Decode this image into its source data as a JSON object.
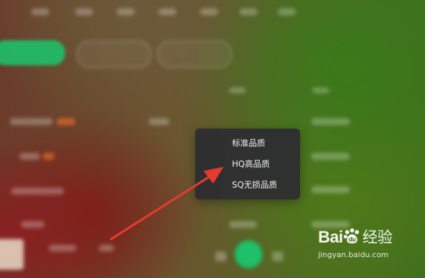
{
  "quality_menu": {
    "items": [
      {
        "label": "标准品质"
      },
      {
        "label": "HQ高品质"
      },
      {
        "label": "SQ无损品质"
      }
    ]
  },
  "annotation": {
    "arrow_color": "#e8392f"
  },
  "watermark": {
    "logo_text": "Bai",
    "logo_suffix": "经验",
    "url": "jingyan.baidu.com"
  },
  "colors": {
    "accent_green": "#1ec06a",
    "menu_bg": "#2c2c30",
    "menu_text": "#f2f2f2"
  }
}
